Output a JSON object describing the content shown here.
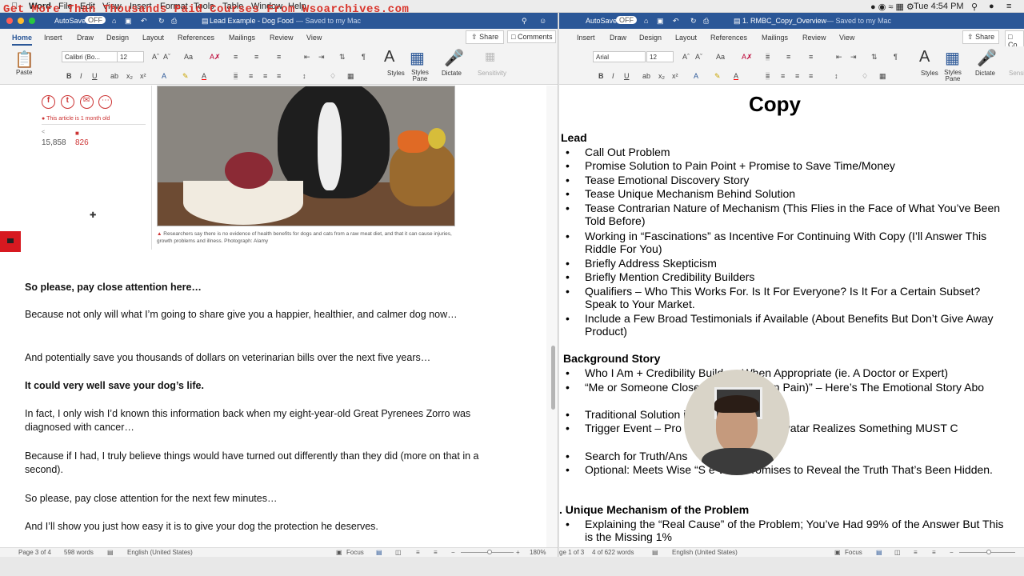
{
  "watermark": "Get More Than Thousands Paid Courses From Wsoarchives.com",
  "menubar": {
    "app": "Word",
    "items": [
      "File",
      "Edit",
      "View",
      "Insert",
      "Format",
      "Tools",
      "Table",
      "Window",
      "Help"
    ],
    "clock": "Tue 4:54 PM"
  },
  "left": {
    "autosave": "AutoSave",
    "autosave_state": "OFF",
    "title": "Lead Example - Dog Food",
    "saved": "— Saved to my Mac",
    "tabs": [
      "Home",
      "Insert",
      "Draw",
      "Design",
      "Layout",
      "References",
      "Mailings",
      "Review",
      "View"
    ],
    "share": "Share",
    "comments": "Comments",
    "font": "Calibri (Bo...",
    "size": "12",
    "ribbon_labels": {
      "paste": "Paste",
      "styles": "Styles",
      "styles_pane": "Styles Pane",
      "dictate": "Dictate",
      "sensitivity": "Sensitivity"
    },
    "article": {
      "notice": "This article is 1 month old",
      "shares": "15,858",
      "comments": "826",
      "caption": "Researchers say there is no evidence of health benefits for dogs and cats from a raw meat diet, and that it can cause injuries, growth problems and illness. Photograph: Alamy"
    },
    "paragraphs": [
      {
        "text": "So please, pay close attention here…",
        "bold": true
      },
      {
        "text": "Because not only will what I’m going to share give you a happier, healthier, and calmer dog now…",
        "bold": false
      },
      {
        "text": "And potentially save you thousands of dollars on veterinarian bills over the next five years…",
        "bold": false
      },
      {
        "text": "It could very well save your dog’s life.",
        "bold": true
      },
      {
        "text": "In fact, I only wish I’d known this information back when my eight-year-old Great Pyrenees Zorro was diagnosed with cancer…",
        "bold": false
      },
      {
        "text": "Because if I had, I truly believe things would have turned out differently than they did (more on that in a second).",
        "bold": false
      },
      {
        "text": "So please, pay close attention for the next few minutes…",
        "bold": false
      },
      {
        "text": "And I’ll show you just how easy it is to give your dog the protection he deserves.",
        "bold": false
      }
    ],
    "status": {
      "page": "Page 3 of 4",
      "words": "598 words",
      "lang": "English (United States)",
      "focus": "Focus",
      "zoom": "180%"
    }
  },
  "right": {
    "autosave": "AutoSave",
    "autosave_state": "OFF",
    "title": "1. RMBC_Copy_Overview",
    "saved": "— Saved to my Mac",
    "tabs": [
      "Insert",
      "Draw",
      "Design",
      "Layout",
      "References",
      "Mailings",
      "Review",
      "View"
    ],
    "share": "Share",
    "comments": "Co",
    "font": "Arial",
    "size": "12",
    "ribbon_labels": {
      "styles": "Styles",
      "styles_pane": "Styles Pane",
      "dictate": "Dictate",
      "sensitivity": "Sensi"
    },
    "doc_title": "Copy",
    "lead_heading": "Lead",
    "lead_bullets": [
      "Call Out Problem",
      "Promise Solution to Pain Point + Promise to Save Time/Money",
      "Tease Emotional Discovery Story",
      "Tease Unique Mechanism Behind Solution",
      "Tease Contrarian Nature of Mechanism (This Flies in the Face of What You’ve Been Told Before)",
      "Working in “Fascinations” as Incentive For Continuing With Copy (I’ll Answer This Riddle For You)",
      "Briefly Address Skepticism",
      "Briefly Mention Credibility Builders",
      "Qualifiers – Who This Works For. Is It For Everyone? Is It For a Certain Subset? Speak to Your Market.",
      "Include a Few Broad Testimonials if Available (About Benefits But Don’t Give Away Product)"
    ],
    "bg_heading": "Background Story",
    "bg_bullets": [
      "Who I Am + Credibility Builders When Appropriate (ie. A Doctor or Expert)",
      "“Me or Someone Close ust Like You (In Pain)” – Here’s The Emotional Story Abo",
      "Traditional Solution ing",
      "Trigger Event – Pro scalated to Where Avatar Realizes Something MUST C",
      "Search for Truth/Ans",
      "Optional: Meets Wise “S e Who Promises to Reveal the Truth That’s Been Hidden."
    ],
    "um_heading": ". Unique Mechanism of the Problem",
    "um_bullets": [
      "Explaining the “Real Cause” of the Problem; You’ve Had 99% of the Answer But This is the Missing 1%"
    ],
    "status": {
      "page": "ge 1 of 3",
      "words": "4 of 622 words",
      "lang": "English (United States)",
      "focus": "Focus"
    }
  }
}
